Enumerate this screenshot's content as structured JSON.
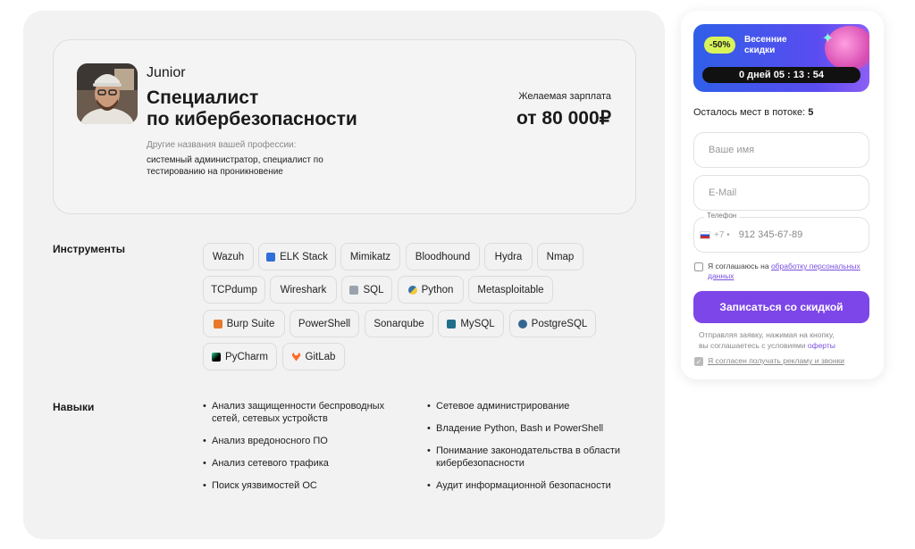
{
  "profile": {
    "level": "Junior",
    "title_line1": "Специалист",
    "title_line2": "по кибербезопасности",
    "alt_names_label": "Другие названия вашей профессии:",
    "alt_names_line1": "системный администратор, специалист по",
    "alt_names_line2": "тестированию на проникновение",
    "salary_label": "Желаемая зарплата",
    "salary_value": "от 80 000₽"
  },
  "tools": {
    "title": "Инструменты",
    "items": [
      "Wazuh",
      "ELK Stack",
      "Mimikatz",
      "Bloodhound",
      "Hydra",
      "Nmap",
      "TCPdump",
      "Wireshark",
      "SQL",
      "Python",
      "Metasploitable",
      "Burp Suite",
      "PowerShell",
      "Sonarqube",
      "MySQL",
      "PostgreSQL",
      "PyCharm",
      "GitLab"
    ]
  },
  "skills": {
    "title": "Навыки",
    "left": [
      {
        "line1": "Анализ защищенности беспроводных",
        "line2": "сетей, сетевых устройств"
      },
      {
        "line1": "Анализ вредоносного ПО",
        "line2": ""
      },
      {
        "line1": "Анализ сетевого трафика",
        "line2": ""
      },
      {
        "line1": "Поиск уязвимостей ОС",
        "line2": ""
      }
    ],
    "right": [
      {
        "line1": "Сетевое администрирование",
        "line2": ""
      },
      {
        "line1": "Владение Python, Bash и PowerShell",
        "line2": ""
      },
      {
        "line1": "Понимание законодательства в области",
        "line2": "кибербезопасности"
      },
      {
        "line1": "Аудит информационной безопасности",
        "line2": ""
      }
    ]
  },
  "promo": {
    "badge": "-50%",
    "text_line1": "Весенние",
    "text_line2": "скидки",
    "timer": "0 дней 05 : 13 : 54"
  },
  "form": {
    "seats_label": "Осталось мест в потоке:",
    "seats_value": "5",
    "name_placeholder": "Ваше имя",
    "email_placeholder": "E-Mail",
    "phone_label": "Телефон",
    "phone_prefix": "+7 •",
    "phone_placeholder": "912 345-67-89",
    "consent_text": "Я соглашаюсь на",
    "consent_link": "обработку персональных данных",
    "submit_label": "Записаться со скидкой",
    "note_line1": "Отправляя заявку, нажимая на кнопку,",
    "note_line2": "вы соглашаетесь с условиями",
    "note_link": "оферты",
    "ads_consent": "Я согласен получать рекламу и звонки"
  },
  "colors": {
    "accent": "#7d46e8",
    "promo_badge": "#d9f45a"
  }
}
